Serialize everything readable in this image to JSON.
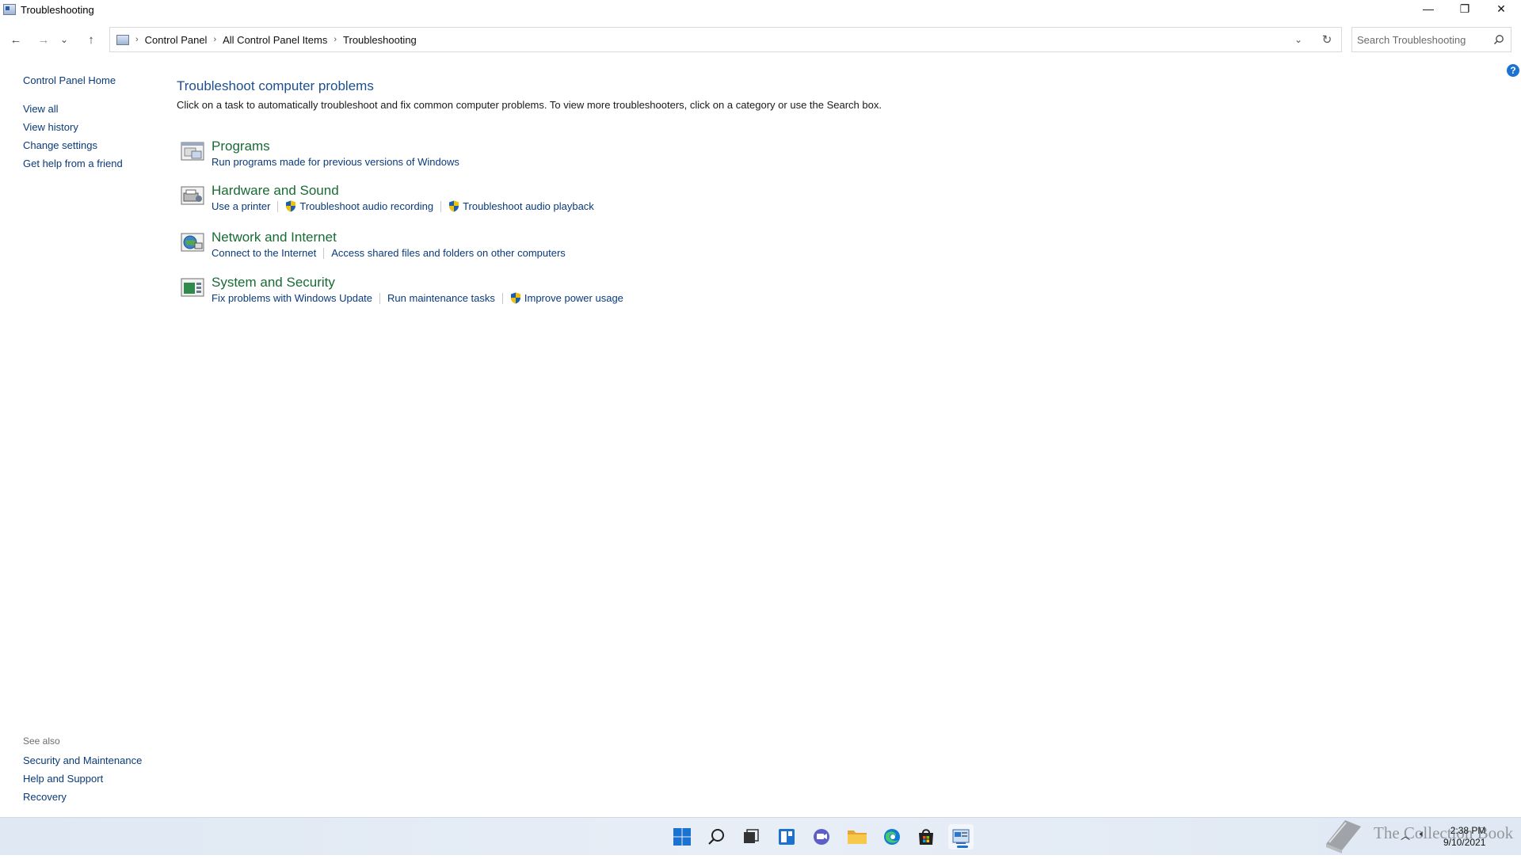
{
  "window": {
    "title": "Troubleshooting",
    "icon": "control-panel-icon"
  },
  "window_controls": {
    "minimize": "—",
    "restore": "❐",
    "close": "✕"
  },
  "nav": {
    "back": "←",
    "forward": "→",
    "recent": "⌄",
    "up": "↑"
  },
  "address": {
    "crumbs": [
      "Control Panel",
      "All Control Panel Items",
      "Troubleshooting"
    ],
    "separator": "›",
    "dropdown": "⌄",
    "refresh": "↻"
  },
  "search": {
    "placeholder": "Search Troubleshooting"
  },
  "left_pane": {
    "home": "Control Panel Home",
    "links": [
      "View all",
      "View history",
      "Change settings",
      "Get help from a friend"
    ]
  },
  "see_also": {
    "header": "See also",
    "links": [
      "Security and Maintenance",
      "Help and Support",
      "Recovery"
    ]
  },
  "help": {
    "label": "?"
  },
  "main": {
    "heading": "Troubleshoot computer problems",
    "description": "Click on a task to automatically troubleshoot and fix common computer problems. To view more troubleshooters, click on a category or use the Search box.",
    "categories": [
      {
        "title": "Programs",
        "icon": "programs-icon",
        "links": [
          {
            "label": "Run programs made for previous versions of Windows",
            "shield": false
          }
        ]
      },
      {
        "title": "Hardware and Sound",
        "icon": "hardware-sound-icon",
        "links": [
          {
            "label": "Use a printer",
            "shield": false
          },
          {
            "label": "Troubleshoot audio recording",
            "shield": true
          },
          {
            "label": "Troubleshoot audio playback",
            "shield": true
          }
        ]
      },
      {
        "title": "Network and Internet",
        "icon": "network-internet-icon",
        "links": [
          {
            "label": "Connect to the Internet",
            "shield": false
          },
          {
            "label": "Access shared files and folders on other computers",
            "shield": false
          }
        ]
      },
      {
        "title": "System and Security",
        "icon": "system-security-icon",
        "links": [
          {
            "label": "Fix problems with Windows Update",
            "shield": false
          },
          {
            "label": "Run maintenance tasks",
            "shield": false
          },
          {
            "label": "Improve power usage",
            "shield": true
          }
        ]
      }
    ]
  },
  "taskbar": {
    "icons": [
      "windows-start-icon",
      "search-icon",
      "task-view-icon",
      "widgets-icon",
      "chat-icon",
      "file-explorer-icon",
      "edge-icon",
      "store-icon",
      "control-panel-icon"
    ],
    "clock_time": "2:38 PM",
    "clock_date": "9/10/2021",
    "tray": {
      "chevron": "︿",
      "speaker": "🔈︎"
    }
  },
  "watermark": {
    "text": "The Collection Book"
  },
  "colors": {
    "link": "#0a3a7a",
    "category_title": "#176b34",
    "heading": "#1d4f91",
    "accent": "#1a73d0"
  }
}
